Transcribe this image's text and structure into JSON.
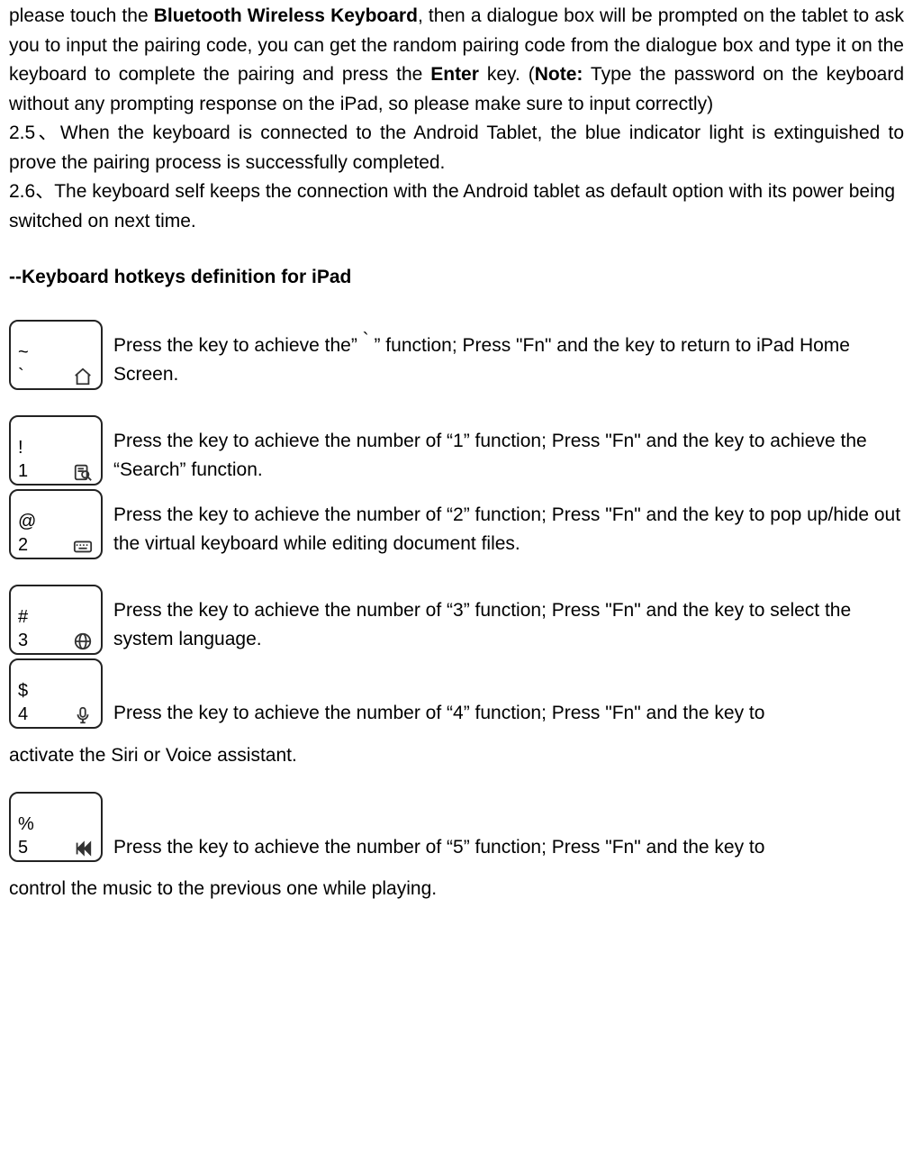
{
  "intro": {
    "p1a": "please touch the ",
    "p1b": "Bluetooth Wireless Keyboard",
    "p1c": ", then a dialogue box will be prompted on the tablet to ask you to input the pairing code, you can get the random pairing code from the dialogue box and type it on the keyboard to complete the pairing and press the ",
    "p1d": "Enter",
    "p1e": " key. (",
    "p1f": "Note:",
    "p1g": " Type the password on the keyboard without any prompting response on the iPad, so please make sure to input correctly)",
    "p2": "2.5、When the keyboard is connected to the Android Tablet, the blue indicator light is extinguished to prove the pairing process is successfully completed.",
    "p3": "2.6、The keyboard self keeps the connection with the Android tablet as default option with its power being switched on next time."
  },
  "section_title": "--Keyboard hotkeys definition for iPad",
  "keys": [
    {
      "top": "~",
      "num": "`",
      "icon": "home",
      "desc1": " Press the key to achieve the” ",
      "desc_mid": "`",
      "desc2": " ” function; Press \"Fn\" and the key to return to iPad Home Screen."
    },
    {
      "top": "!",
      "num": "1",
      "icon": "search",
      "desc1": "Press the key to achieve the number of “1” function; Press \"Fn\" and the key to achieve the “Search” function."
    },
    {
      "top": "@",
      "num": "2",
      "icon": "keyboard",
      "desc1": "Press the key to achieve the number of “2” function; Press \"Fn\" and the key to pop up/hide out the virtual keyboard while editing document files."
    },
    {
      "top": "#",
      "num": "3",
      "icon": "globe",
      "desc1": "Press the key to achieve the number of “3” function; Press \"Fn\" and the key to select the system language."
    },
    {
      "top": "$",
      "num": "4",
      "icon": "mic",
      "desc1": "Press the key to achieve the number of “4” function; Press \"Fn\" and the key to",
      "cont": "activate the Siri or Voice assistant."
    },
    {
      "top": "%",
      "num": "5",
      "icon": "prev",
      "desc1": "Press the key to achieve the number of “5” function; Press \"Fn\" and the key to",
      "cont": "control the music to the previous one while playing."
    }
  ]
}
